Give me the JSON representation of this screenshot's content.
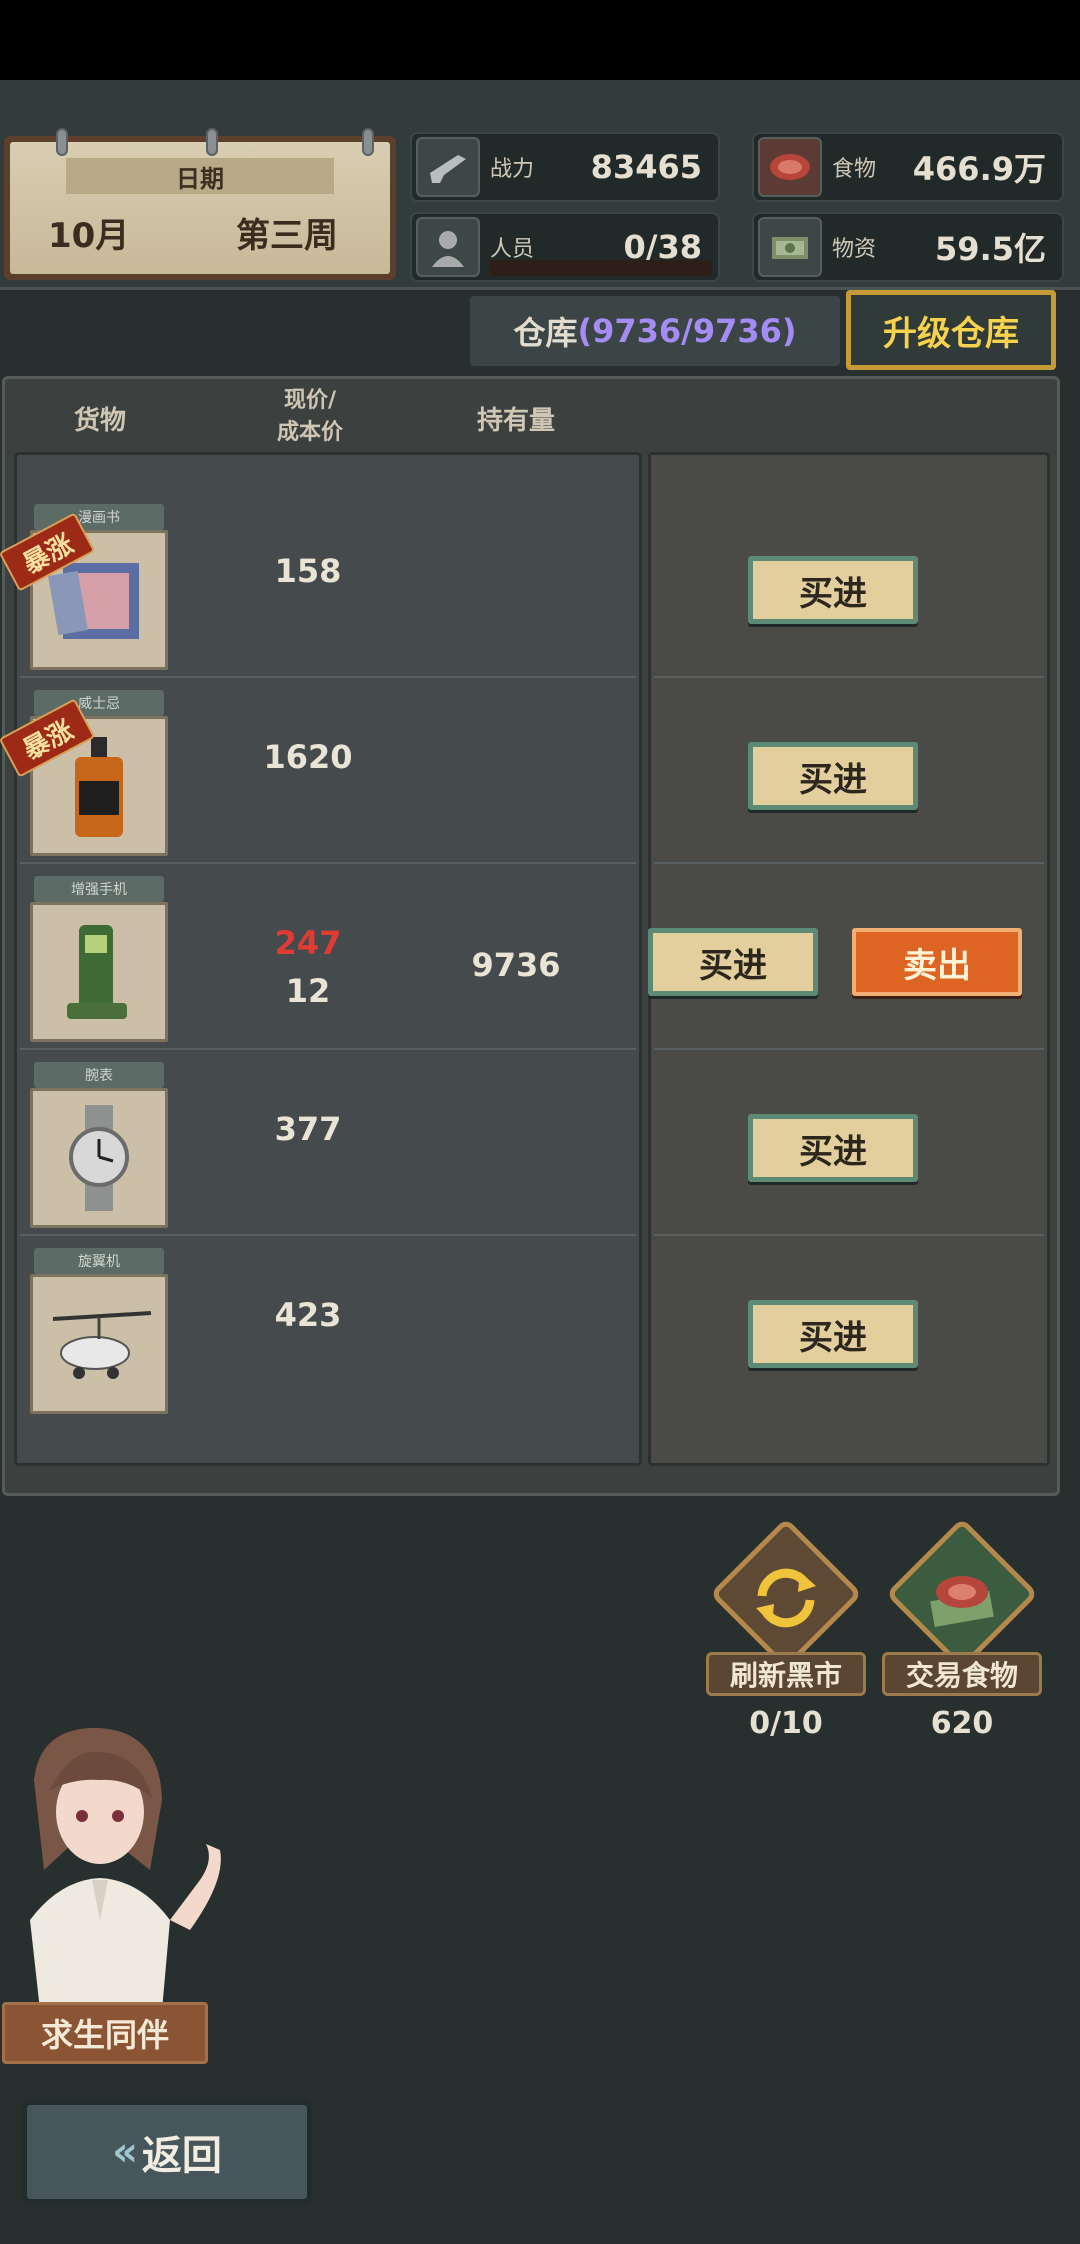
{
  "header": {
    "date_label": "日期",
    "month": "10月",
    "week": "第三周",
    "stats": {
      "power": {
        "label": "战力",
        "value": "83465",
        "icon": "gun-icon"
      },
      "food": {
        "label": "食物",
        "value": "466.9万",
        "icon": "meat-icon"
      },
      "staff": {
        "label": "人员",
        "value": "0/38",
        "icon": "person-icon"
      },
      "supplies": {
        "label": "物资",
        "value": "59.5亿",
        "icon": "money-icon"
      }
    }
  },
  "warehouse": {
    "label": "仓库",
    "count": "(9736/9736)",
    "upgrade_label": "升级仓库"
  },
  "table": {
    "headers": {
      "goods": "货物",
      "price_line1": "现价/",
      "price_line2": "成本价",
      "holding": "持有量"
    },
    "surge_label": "暴涨",
    "buy_label": "买进",
    "sell_label": "卖出",
    "rows": [
      {
        "tag": "漫画书",
        "icon": "comic-book-icon",
        "price": "158"
      },
      {
        "tag": "威士忌",
        "icon": "whiskey-bottle-icon",
        "price": "1620"
      },
      {
        "tag": "增强手机",
        "icon": "walkie-talkie-icon",
        "price": "247",
        "cost": "12",
        "holding": "9736"
      },
      {
        "tag": "腕表",
        "icon": "wristwatch-icon",
        "price": "377"
      },
      {
        "tag": "旋翼机",
        "icon": "gyrocopter-icon",
        "price": "423"
      }
    ]
  },
  "actions": {
    "refresh": {
      "label": "刷新黑市",
      "count": "0/10",
      "icon": "refresh-icon"
    },
    "trade_food": {
      "label": "交易食物",
      "count": "620",
      "icon": "steak-cash-icon"
    }
  },
  "companion": {
    "label": "求生同伴"
  },
  "back": {
    "label": "返回"
  },
  "colors": {
    "background": "#27302f",
    "accent_gold": "#f7d24c",
    "warehouse_count": "#a58cf5",
    "price_up_red": "#e23b34",
    "sell_orange": "#de6424",
    "buy_tan": "#e3cf9d"
  }
}
